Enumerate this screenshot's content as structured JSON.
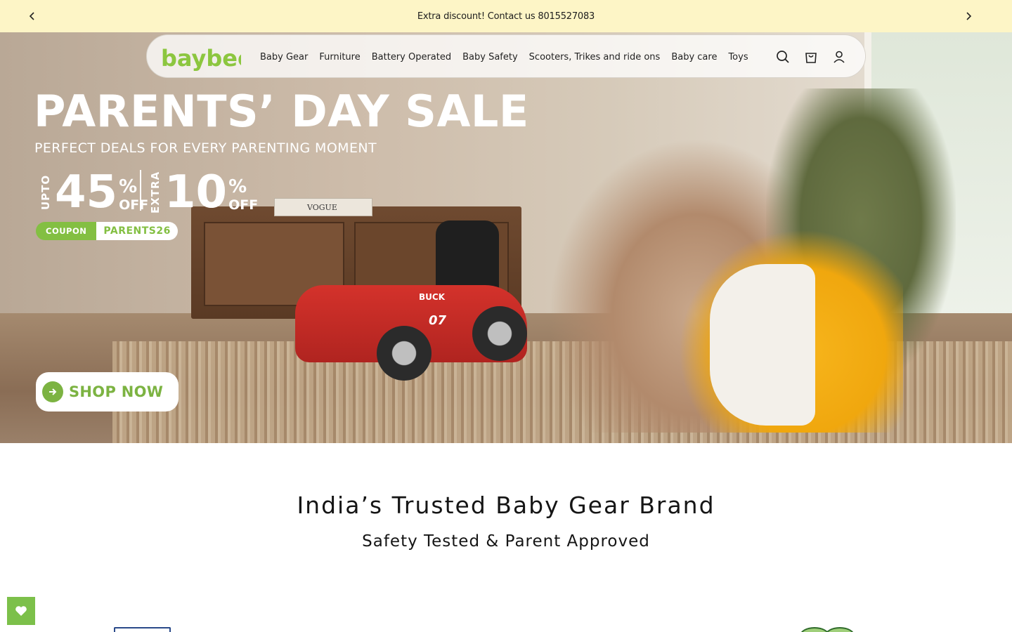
{
  "announcement": {
    "text": "Extra discount! Contact us 8015527083",
    "prev_icon": "chevron-left-icon",
    "next_icon": "chevron-right-icon"
  },
  "nav": {
    "logo_text": "baybee",
    "links": [
      "Baby Gear",
      "Furniture",
      "Battery Operated",
      "Baby Safety",
      "Scooters, Trikes and ride ons",
      "Baby care",
      "Toys"
    ],
    "icons": [
      "search-icon",
      "cart-icon",
      "account-icon"
    ]
  },
  "hero": {
    "title": "PARENTS’ DAY SALE",
    "subtitle": "PERFECT DEALS FOR EVERY PARENTING MOMENT",
    "offer_one": {
      "prefix": "UPTO",
      "number": "45",
      "percent": "%",
      "suffix": "OFF"
    },
    "offer_two": {
      "prefix": "EXTRA",
      "number": "10",
      "percent": "%",
      "suffix": "OFF"
    },
    "coupon_label": "COUPON",
    "coupon_code": "PARENTS26",
    "cta_label": "SHOP NOW",
    "car_text": "BUCK",
    "car_number": "07",
    "book_text": "VOGUE"
  },
  "trust": {
    "title": "India’s Trusted Baby Gear Brand",
    "subtitle": "Safety Tested & Parent Approved"
  },
  "wishlist": {
    "icon": "heart-icon"
  },
  "colors": {
    "announcement_bg": "#fdf5c6",
    "brand_green": "#7cb342",
    "logo_green": "#8cc63f"
  }
}
